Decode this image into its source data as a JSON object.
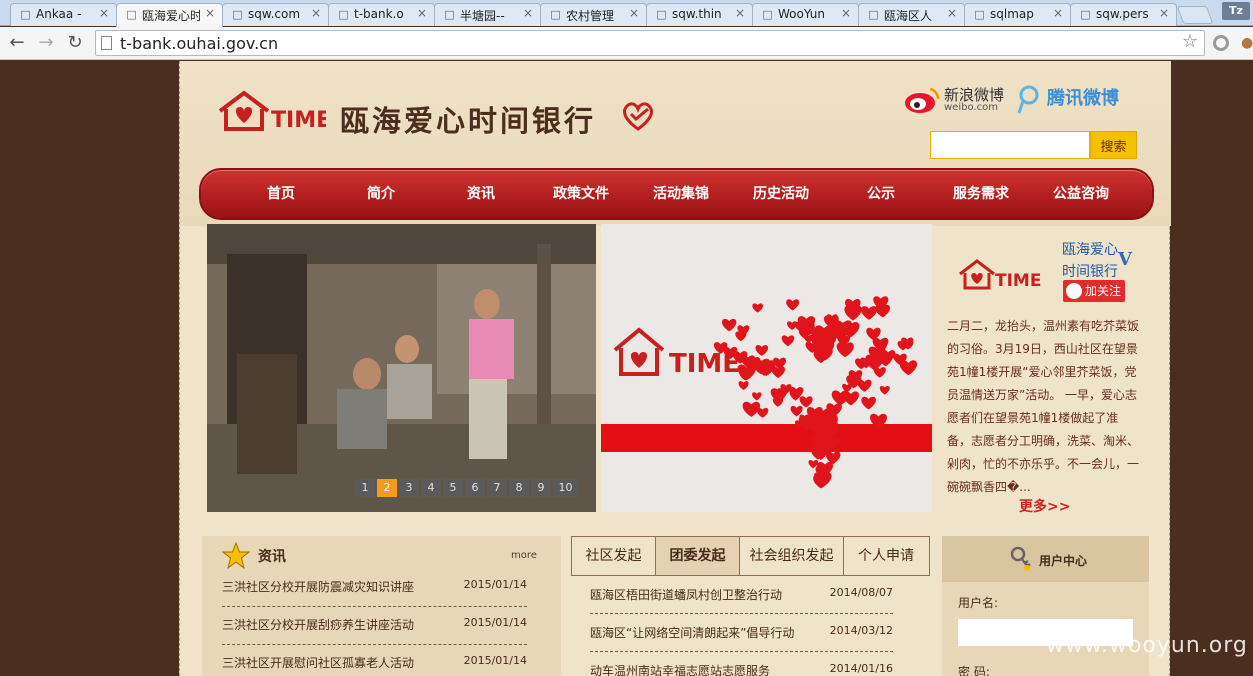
{
  "browser": {
    "tabs": [
      {
        "title": "Ankaa - ",
        "icon": "page-icon"
      },
      {
        "title": "瓯海爱心时",
        "icon": "page-icon",
        "active": true
      },
      {
        "title": "sqw.com",
        "icon": "page-icon"
      },
      {
        "title": "t-bank.o",
        "icon": "page-icon"
      },
      {
        "title": "半塘园--",
        "icon": "page-icon"
      },
      {
        "title": "农村管理",
        "icon": "page-icon"
      },
      {
        "title": "sqw.thin",
        "icon": "page-icon"
      },
      {
        "title": "WooYun",
        "icon": "page-icon"
      },
      {
        "title": "瓯海区人",
        "icon": "page-icon"
      },
      {
        "title": "sqlmap",
        "icon": "page-icon"
      },
      {
        "title": "sqw.pers",
        "icon": "page-icon"
      }
    ],
    "close_glyph": "×",
    "profile": "Tz",
    "url": "t-bank.ouhai.gov.cn"
  },
  "site": {
    "title": "瓯海爱心时间银行",
    "logo_text": "TIME",
    "sina_weibo": "新浪微博",
    "sina_weibo_sub": "weibo.com",
    "tencent_weibo": "腾讯微博",
    "search_button": "搜索",
    "nav": [
      "首页",
      "简介",
      "资讯",
      "政策文件",
      "活动集锦",
      "历史活动",
      "公示",
      "服务需求",
      "公益咨询"
    ],
    "slider_pages": [
      "1",
      "2",
      "3",
      "4",
      "5",
      "6",
      "7",
      "8",
      "9",
      "10"
    ],
    "slider_active_page": 2,
    "banner_logo_text": "TIME"
  },
  "weibo_widget": {
    "name_line1": "瓯海爱心",
    "name_line2": "时间银行",
    "verified": "V",
    "follow": "加关注",
    "post": "二月二，龙抬头，温州素有吃芥菜饭的习俗。3月19日，西山社区在望景苑1幢1楼开展“爱心邻里芥菜饭，党员温情送万家”活动。 一早，爱心志愿者们在望景苑1幢1楼做起了准备，志愿者分工明确，洗菜、淘米、剁肉，忙的不亦乐乎。不一会儿，一碗碗飘香四�...",
    "more": "更多>>"
  },
  "news": {
    "title": "资讯",
    "more": "more",
    "items": [
      {
        "title": "三洪社区分校开展防震减灾知识讲座",
        "date": "2015/01/14"
      },
      {
        "title": "三洪社区分校开展刮痧养生讲座活动",
        "date": "2015/01/14"
      },
      {
        "title": "三洪社区开展慰问社区孤寡老人活动",
        "date": "2015/01/14"
      }
    ]
  },
  "activities": {
    "tabs": [
      "社区发起",
      "团委发起",
      "社会组织发起",
      "个人申请"
    ],
    "active_tab": 1,
    "items": [
      {
        "title": "瓯海区梧田街道蟠凤村创卫整治行动",
        "date": "2014/08/07"
      },
      {
        "title": "瓯海区“让网络空间清朗起来”倡导行动",
        "date": "2014/03/12"
      },
      {
        "title": "动车温州南站幸福志愿站志愿服务",
        "date": "2014/01/16"
      }
    ]
  },
  "user_center": {
    "title": "用户中心",
    "username_label": "用户名:",
    "password_label": "密 码:"
  },
  "watermark": "www.wooyun.org",
  "colors": {
    "nav_red": "#b01d1f",
    "page_bg": "#efe3c9",
    "side_bg": "#4a2e1e",
    "search_yellow": "#f5c000"
  }
}
